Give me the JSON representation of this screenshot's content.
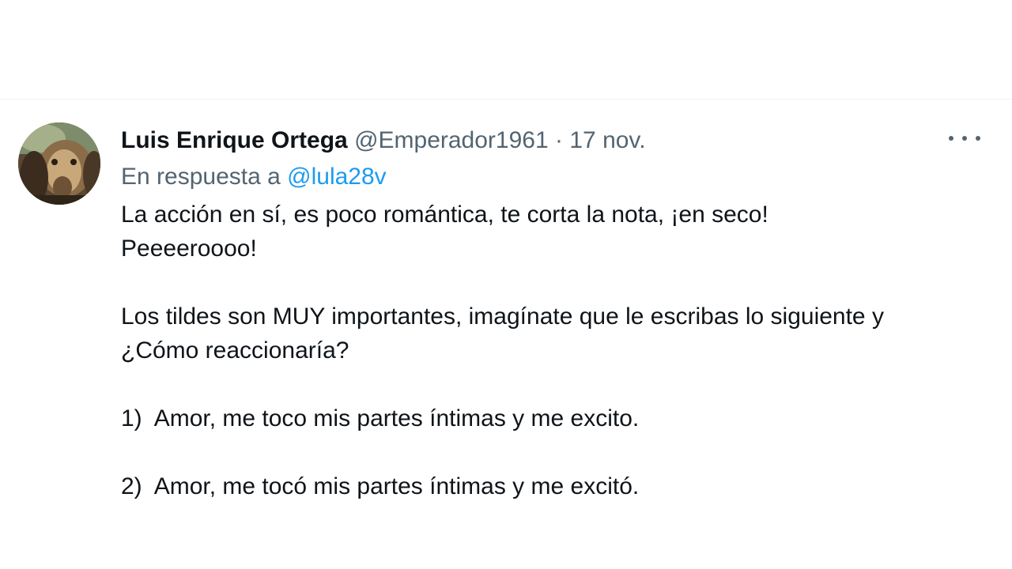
{
  "tweet": {
    "author_name": "Luis Enrique Ortega",
    "author_handle": "@Emperador1961",
    "separator": "·",
    "timestamp": "17 nov.",
    "reply_prefix": "En respuesta a ",
    "reply_to": "@lula28v",
    "avatar_icon": "avatar-photo",
    "more_icon": "more-options-icon",
    "body_lines": [
      "La acción en sí, es poco romántica, te corta la nota, ¡en seco!",
      "Peeeeroooo!",
      "",
      "Los tildes son MUY importantes, imagínate que le escribas lo siguiente y",
      "¿Cómo reaccionaría?",
      "",
      "1)  Amor, me toco mis partes íntimas y me excito.",
      "",
      "2)  Amor, me tocó mis partes íntimas y me excitó."
    ]
  },
  "colors": {
    "primary_text": "#0f1419",
    "secondary_text": "#536471",
    "link": "#1d9bf0",
    "divider": "#eff3f4"
  }
}
